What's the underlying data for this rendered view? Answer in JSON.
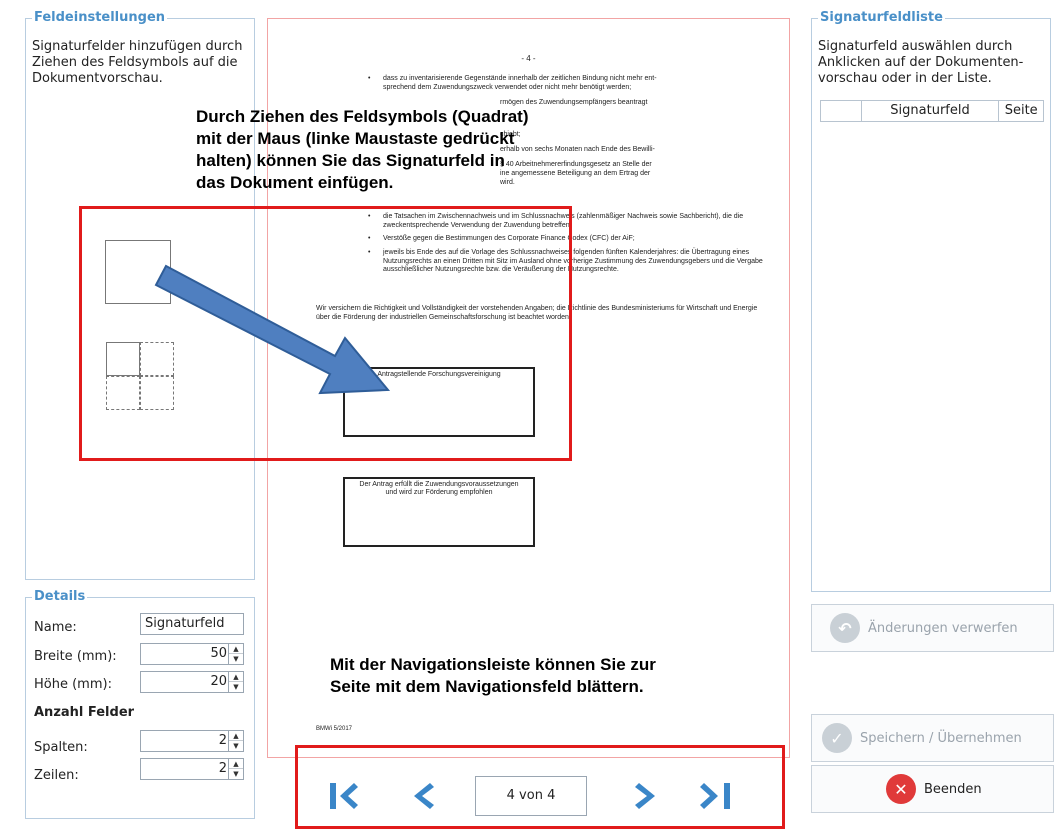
{
  "field_settings": {
    "title": "Feldeinstellungen",
    "hint": "Signaturfelder hinzufügen durch Ziehen des Feldsymbols auf die Dokumentvorschau."
  },
  "details": {
    "title": "Details",
    "name_label": "Name:",
    "name_value": "Signaturfeld",
    "width_label": "Breite (mm):",
    "width_value": "50",
    "height_label": "Höhe (mm):",
    "height_value": "20",
    "count_heading": "Anzahl Felder",
    "columns_label": "Spalten:",
    "columns_value": "2",
    "rows_label": "Zeilen:",
    "rows_value": "2"
  },
  "document": {
    "page_number": "- 4 -",
    "bullets_top": [
      "dass zu inventarisierende Gegenstände innerhalb der zeitlichen Bindung nicht mehr ent-",
      "sprechend dem Zuwendungszweck verwendet oder nicht mehr benötigt werden;",
      "rmögen des Zuwendungsempfängers beantragt",
      "chiebt;",
      "erhalb von sechs Monaten nach Ende des Bewilli-",
      "§ 40 Arbeitnehmererfindungsgesetz an Stelle der",
      "ine angemessene Beteiligung an dem Ertrag der",
      "wird."
    ],
    "bullets_mid": [
      "die Tatsachen im Zwischennachweis und im Schlussnachweis (zahlenmäßiger Nachweis sowie Sachbericht), die die zweckentsprechende Verwendung der Zuwendung betreffen;",
      "Verstöße gegen die Bestimmungen des Corporate Finance Codex (CFC) der AiF;",
      "jeweils bis Ende des auf die Vorlage des Schlussnachweises folgenden fünften Kalenderjahres: die Übertragung eines Nutzungsrechts an einen Dritten mit Sitz im Ausland ohne vorherige Zustimmung des Zuwendungsgebers und die Vergabe ausschließlicher Nutzungsrechte bzw. die Veräußerung der Nutzungsrechte."
    ],
    "paragraph": "Wir versichern die Richtigkeit und Vollständigkeit der vorstehenden Angaben; die Richtlinie des Bundesministeriums für Wirtschaft und Energie über die Förderung der industriellen Gemeinschaftsforschung ist beachtet worden.",
    "sig1": "Antragstellende Forschungsvereinigung",
    "sig2": "Der Antrag erfüllt die Zuwendungsvoraussetzungen und wird zur Förderung empfohlen",
    "footer": "BMWi 5/2017"
  },
  "callouts": {
    "drag": "Durch Ziehen des Feldsymbols (Quadrat) mit der Maus (linke Maustaste gedrückt halten) können Sie das Signaturfeld in das Dokument einfügen.",
    "nav": "Mit der Navigationsleiste können Sie zur Seite mit dem Navigationsfeld blättern."
  },
  "signature_list": {
    "title": "Signaturfeldliste",
    "hint": "Signaturfeld auswählen durch Anklicken auf der Dokumenten-vorschau oder in der Liste.",
    "columns": [
      "",
      "Signaturfeld",
      "Seite"
    ]
  },
  "buttons": {
    "discard": "Änderungen verwerfen",
    "save": "Speichern / Übernehmen",
    "exit": "Beenden"
  },
  "navigation": {
    "page_indicator": "4 von 4"
  },
  "colors": {
    "accent": "#4a90c8",
    "highlight": "#e11b1b",
    "arrow": "#4f7fc0",
    "nav_icon": "#3a86c8"
  }
}
